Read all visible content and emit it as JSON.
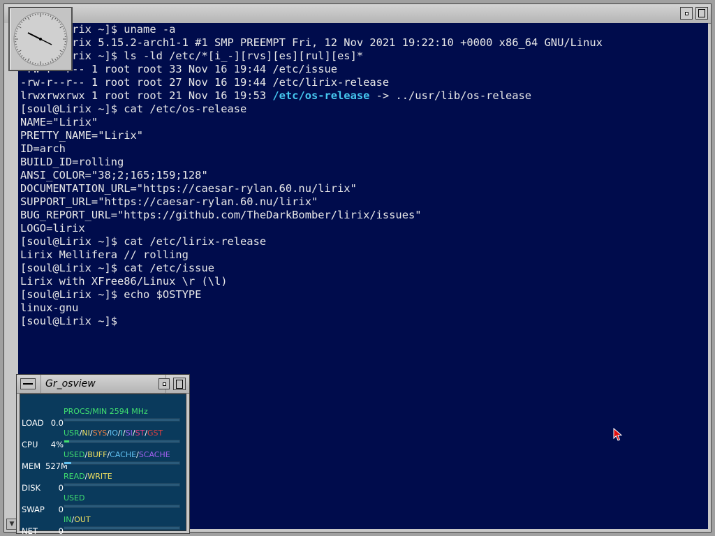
{
  "terminal": {
    "lines": [
      "[soul@Lirix ~]$ uname -a",
      "Linux Lirix 5.15.2-arch1-1 #1 SMP PREEMPT Fri, 12 Nov 2021 19:22:10 +0000 x86_64 GNU/Linux",
      "[soul@Lirix ~]$ ls -ld /etc/*[i_-][rvs][es][rul][es]*",
      "-rw-r--r-- 1 root root 33 Nov 16 19:44 /etc/issue",
      "-rw-r--r-- 1 root root 27 Nov 16 19:44 /etc/lirix-release",
      "lrwxrwxrwx 1 root root 21 Nov 16 19:53 ",
      "[soul@Lirix ~]$ cat /etc/os-release",
      "NAME=\"Lirix\"",
      "PRETTY_NAME=\"Lirix\"",
      "ID=arch",
      "BUILD_ID=rolling",
      "ANSI_COLOR=\"38;2;165;159;128\"",
      "DOCUMENTATION_URL=\"https://caesar-rylan.60.nu/lirix\"",
      "SUPPORT_URL=\"https://caesar-rylan.60.nu/lirix\"",
      "BUG_REPORT_URL=\"https://github.com/TheDarkBomber/lirix/issues\"",
      "LOGO=lirix",
      "[soul@Lirix ~]$ cat /etc/lirix-release",
      "Lirix Mellifera // rolling",
      "[soul@Lirix ~]$ cat /etc/issue",
      "Lirix with XFree86/Linux \\r (\\l)",
      "[soul@Lirix ~]$ echo $OSTYPE",
      "linux-gnu",
      "[soul@Lirix ~]$ "
    ],
    "symlink_name": "/etc/os-release",
    "symlink_target": " -> ../usr/lib/os-release"
  },
  "osview": {
    "title": "Gr_osview",
    "rows": [
      {
        "label": "LOAD",
        "value": "0.0",
        "legend": [
          {
            "text": "PROCS/MIN  2594 MHz",
            "color": "#40e070"
          }
        ],
        "fill": 0.0,
        "fill_color": "#40e070"
      },
      {
        "label": "CPU",
        "value": "4%",
        "legend": [
          {
            "text": "USR",
            "color": "#40e070"
          },
          {
            "text": "/",
            "color": "#ffffff"
          },
          {
            "text": "NI",
            "color": "#f0e060"
          },
          {
            "text": "/",
            "color": "#ffffff"
          },
          {
            "text": "SYS",
            "color": "#f08040"
          },
          {
            "text": "/",
            "color": "#ffffff"
          },
          {
            "text": "IO",
            "color": "#60c0f0"
          },
          {
            "text": "/",
            "color": "#ffffff"
          },
          {
            "text": "I",
            "color": "#40d0d0"
          },
          {
            "text": "/",
            "color": "#ffffff"
          },
          {
            "text": "SI",
            "color": "#a060f0"
          },
          {
            "text": "/",
            "color": "#ffffff"
          },
          {
            "text": "ST",
            "color": "#f04080"
          },
          {
            "text": "/",
            "color": "#ffffff"
          },
          {
            "text": "GST",
            "color": "#e04040"
          }
        ],
        "fill": 0.04,
        "fill_color": "#40e070"
      },
      {
        "label": "MEM",
        "value": "527M",
        "legend": [
          {
            "text": "USED",
            "color": "#40e070"
          },
          {
            "text": "/",
            "color": "#ffffff"
          },
          {
            "text": "BUFF",
            "color": "#f0e060"
          },
          {
            "text": "/",
            "color": "#ffffff"
          },
          {
            "text": "CACHE",
            "color": "#60c0f0"
          },
          {
            "text": "/",
            "color": "#ffffff"
          },
          {
            "text": "SCACHE",
            "color": "#a060f0"
          }
        ],
        "fill": 0.06,
        "fill_color": "#60c0f0"
      },
      {
        "label": "DISK",
        "value": "0",
        "legend": [
          {
            "text": "READ",
            "color": "#40e070"
          },
          {
            "text": "/",
            "color": "#ffffff"
          },
          {
            "text": "WRITE",
            "color": "#f0e060"
          }
        ],
        "fill": 0.0,
        "fill_color": "#40e070"
      },
      {
        "label": "SWAP",
        "value": "0",
        "legend": [
          {
            "text": "USED",
            "color": "#40e070"
          }
        ],
        "fill": 0.0,
        "fill_color": "#40e070"
      },
      {
        "label": "NET",
        "value": "0",
        "legend": [
          {
            "text": "IN",
            "color": "#40e070"
          },
          {
            "text": "/",
            "color": "#ffffff"
          },
          {
            "text": "OUT",
            "color": "#f0e060"
          }
        ],
        "fill": 0.0,
        "fill_color": "#40e070"
      }
    ]
  },
  "icons": {
    "clock": "analog-clock-icon",
    "cursor": "arrow-cursor-icon"
  },
  "colors": {
    "terminal_bg": "#000c4c",
    "terminal_fg": "#e8e8e8",
    "symlink": "#46c8f0",
    "osview_bg": "#0a3a5c"
  }
}
